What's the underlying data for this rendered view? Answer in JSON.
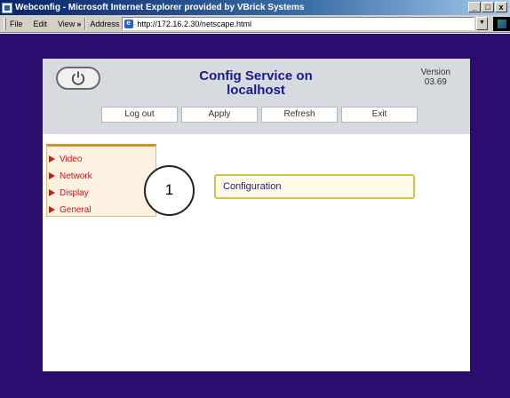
{
  "window": {
    "title": "Webconfig - Microsoft Internet Explorer provided by VBrick Systems",
    "controls": [
      "_",
      "□",
      "x"
    ]
  },
  "menubar": {
    "items": [
      "File",
      "Edit",
      "View"
    ],
    "chevron": "»",
    "address_label": "Address",
    "address_url": "http://172.16.2.30/netscape.html"
  },
  "header": {
    "title_line1": "Config Service on",
    "title_line2": "localhost",
    "version_label": "Version",
    "version_value": "03.69",
    "buttons": [
      "Log out",
      "Apply",
      "Refresh",
      "Exit"
    ]
  },
  "nav": {
    "items": [
      "Video",
      "Network",
      "Display",
      "General"
    ]
  },
  "callout_number": "1",
  "config_label": "Configuration",
  "colors": {
    "page_background": "#2a0d6e",
    "header_background": "#d7dbdf",
    "title_color": "#1a1a8c",
    "nav_text": "#cc1a1a",
    "config_border": "#d4c34a"
  },
  "icons": [
    "ie-app-icon",
    "ie-address-icon",
    "power-icon",
    "throbber-logo",
    "triangle-arrow-icon"
  ]
}
